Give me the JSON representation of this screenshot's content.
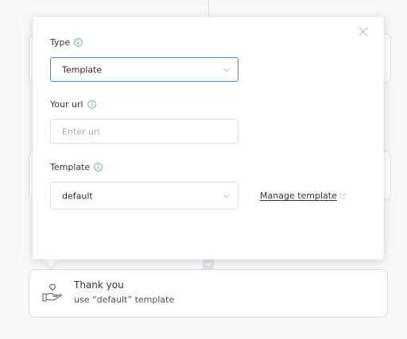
{
  "panel": {
    "type_field": {
      "label": "Type",
      "selected": "Template"
    },
    "url_field": {
      "label": "Your url",
      "placeholder": "Enter url",
      "value": ""
    },
    "template_field": {
      "label": "Template",
      "selected": "default",
      "manage_link": "Manage template"
    }
  },
  "step_card": {
    "title": "Thank you",
    "subtitle": "use “default” template"
  },
  "colors": {
    "focus_border": "#3d8bd9",
    "info_icon": "#4caf7d",
    "border": "#dfe3e8",
    "text": "#2f3640",
    "placeholder": "#a4abb3"
  },
  "icons": {
    "close": "close-icon",
    "info": "info-icon",
    "chevron": "chevron-down-icon",
    "external": "external-link-icon",
    "step": "hand-heart-icon"
  }
}
